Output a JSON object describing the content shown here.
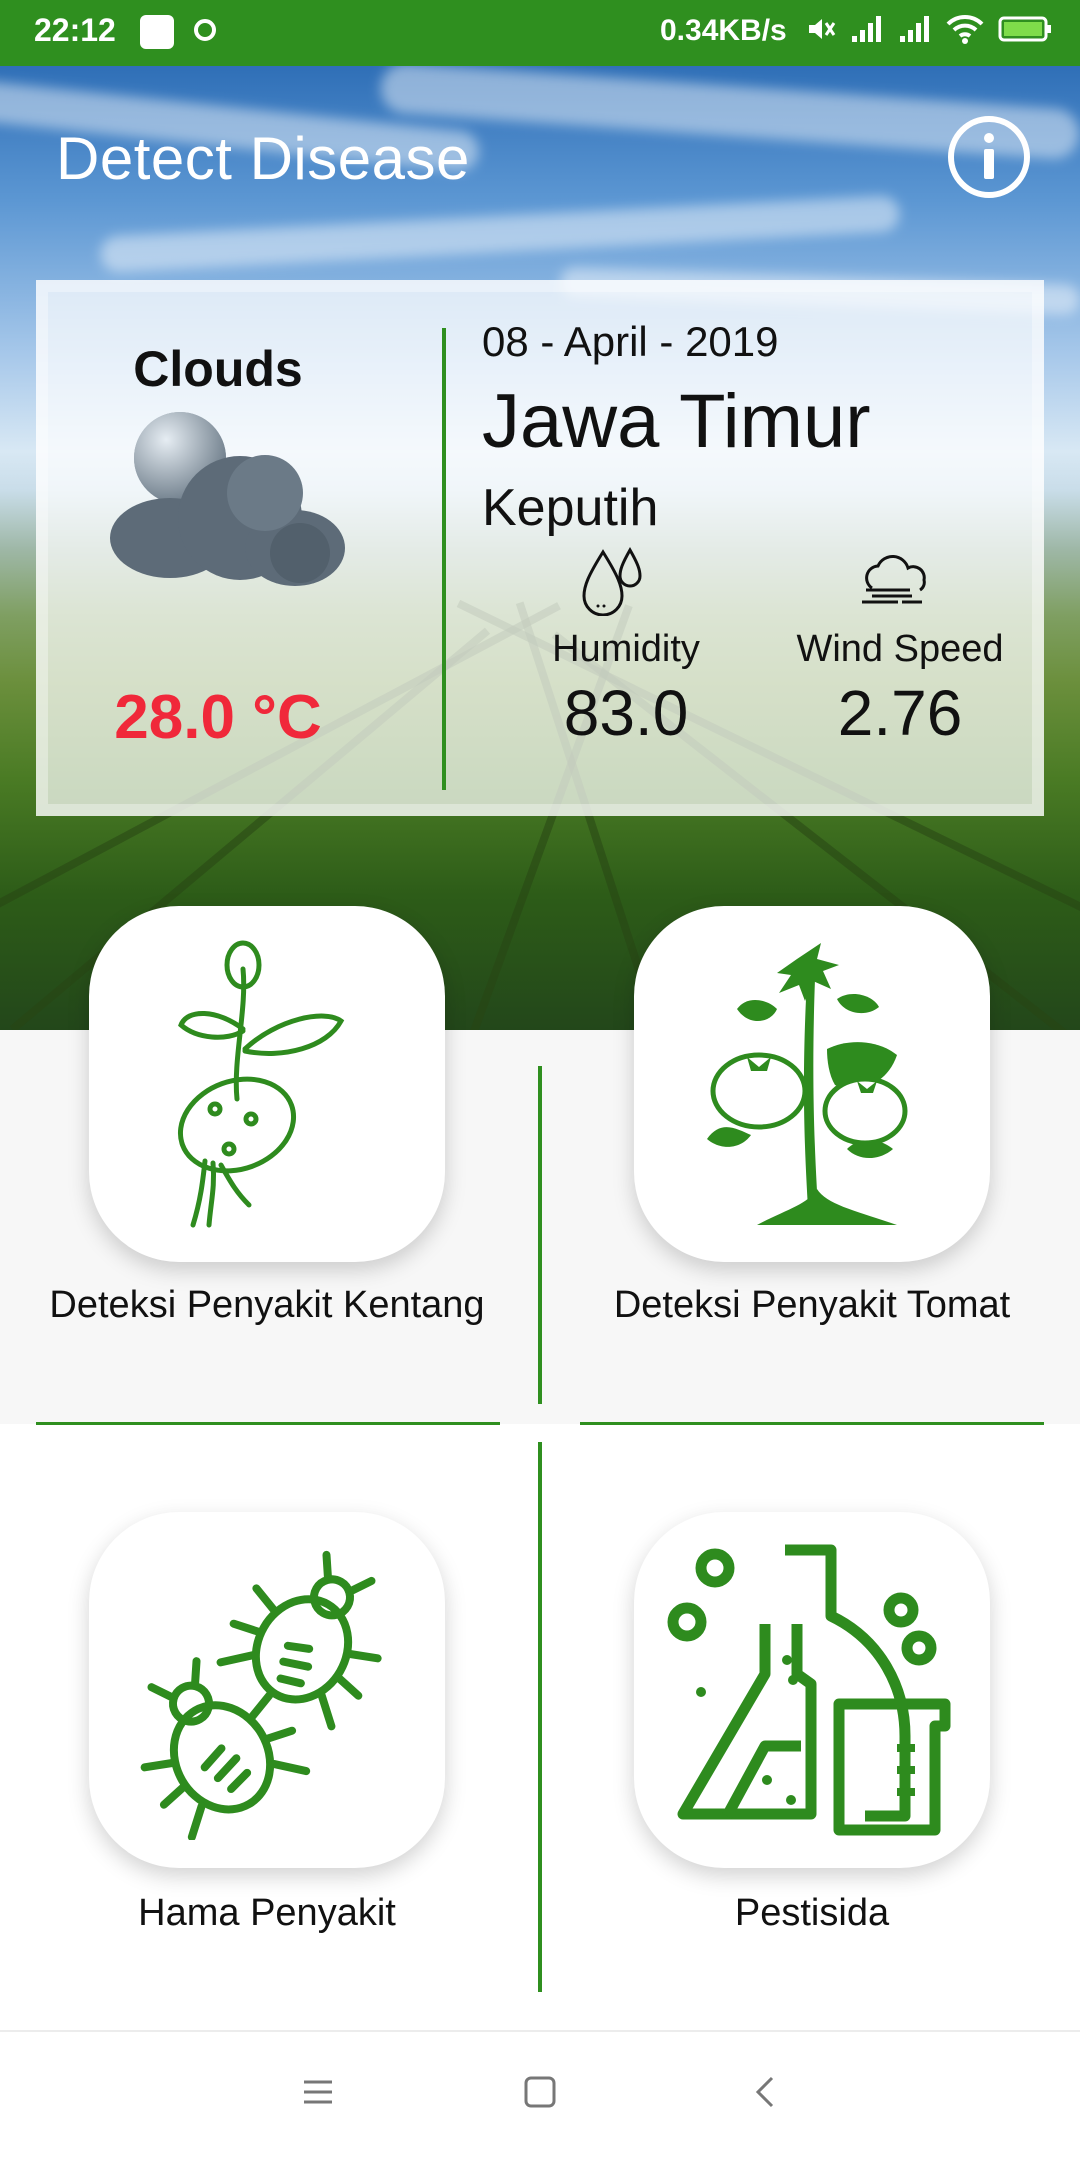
{
  "status_bar": {
    "time": "22:12",
    "speed": "0.34KB/s",
    "icons": [
      "mi-icon",
      "chat-bubble-icon",
      "mute-icon",
      "signal-icon",
      "signal-icon",
      "wifi-icon",
      "battery-icon"
    ]
  },
  "header": {
    "title": "Detect Disease",
    "info_icon": "info-circle-icon"
  },
  "weather": {
    "condition": "Clouds",
    "condition_icon": "cloud-icon",
    "temperature": "28.0 °C",
    "date": "08 - April - 2019",
    "region": "Jawa Timur",
    "city": "Keputih",
    "humidity_label": "Humidity",
    "humidity_value": "83.0",
    "humidity_icon": "water-drops-icon",
    "wind_label": "Wind Speed",
    "wind_value": "2.76",
    "wind_icon": "wind-cloud-icon"
  },
  "menu": [
    {
      "label": "Deteksi Penyakit Kentang",
      "icon": "potato-plant-icon"
    },
    {
      "label": "Deteksi Penyakit Tomat",
      "icon": "tomato-plant-icon"
    },
    {
      "label": "Hama Penyakit",
      "icon": "bugs-icon"
    },
    {
      "label": "Pestisida",
      "icon": "chemistry-flask-icon"
    }
  ],
  "colors": {
    "primary_green": "#2f8f1f",
    "temperature_red": "#f0283a",
    "icon_green": "#2e8b1e"
  },
  "nav_bar": [
    "menu-lines-icon",
    "home-square-icon",
    "back-chevron-icon"
  ]
}
